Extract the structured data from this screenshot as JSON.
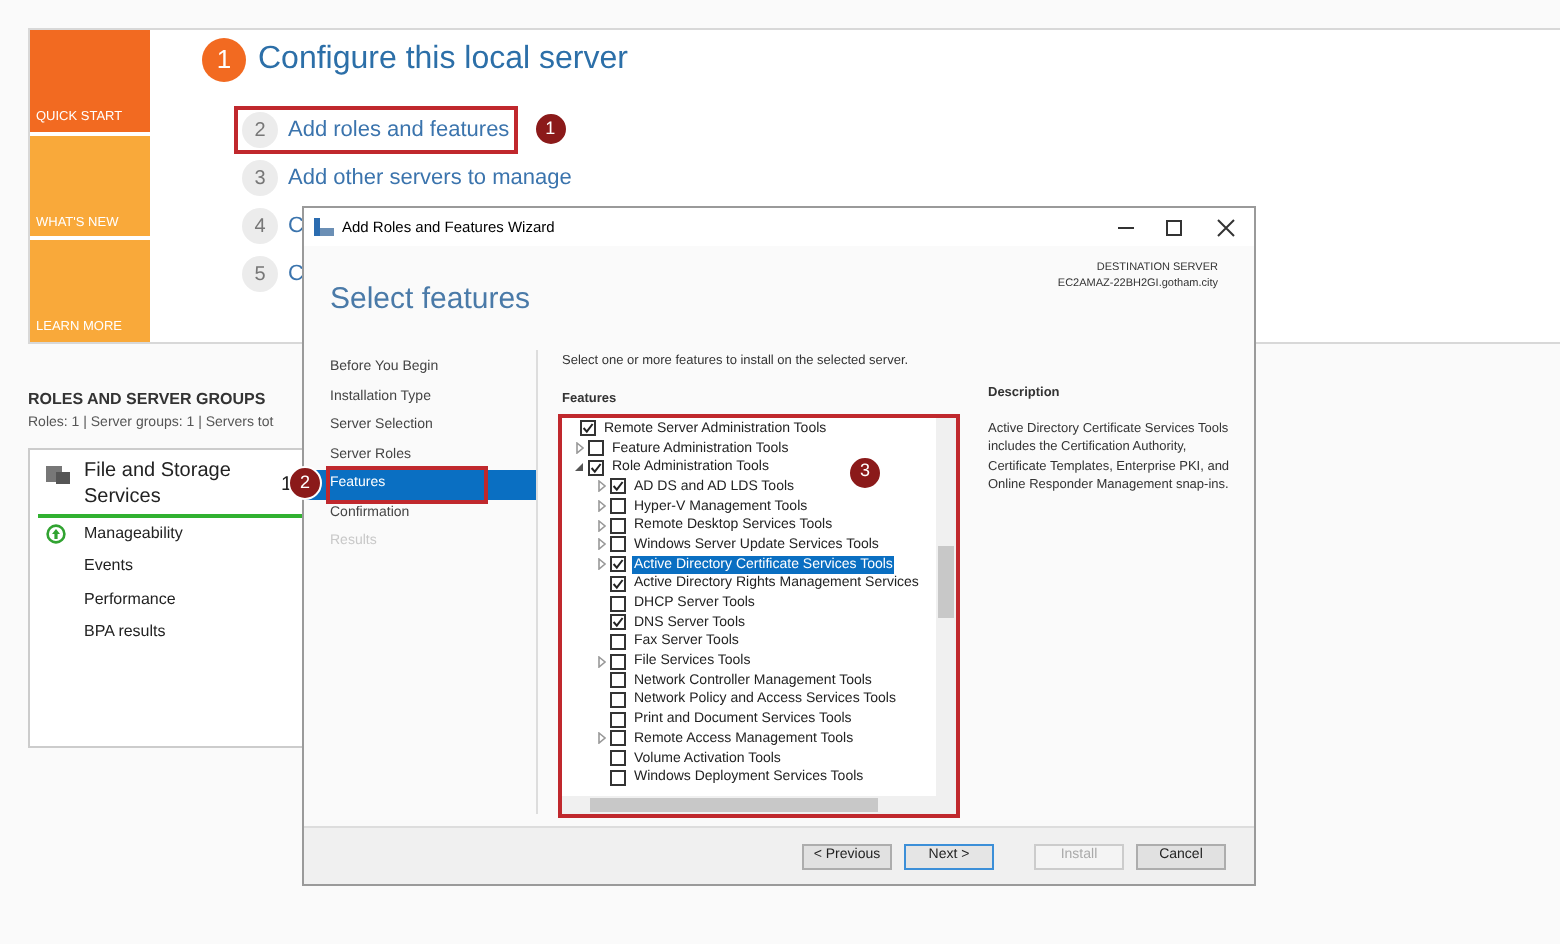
{
  "tiles": [
    {
      "label": "QUICK START",
      "selected": true
    },
    {
      "label": "WHAT'S NEW",
      "selected": false
    },
    {
      "label": "LEARN MORE",
      "selected": false
    }
  ],
  "quick_start": {
    "number": "1",
    "title": "Configure this local server",
    "steps": [
      {
        "number": "2",
        "label": "Add roles and features",
        "highlighted": true,
        "callout": "1"
      },
      {
        "number": "3",
        "label": "Add other servers to manage",
        "highlighted": false
      },
      {
        "number": "4",
        "label": "C",
        "highlighted": false
      },
      {
        "number": "5",
        "label": "C",
        "highlighted": false
      }
    ]
  },
  "roles_and_groups": {
    "heading": "ROLES AND SERVER GROUPS",
    "summary": "Roles: 1  |  Server groups: 1  |  Servers tot",
    "card": {
      "title": "File and Storage Services",
      "count": "1",
      "items": [
        {
          "label": "Manageability",
          "kind": "status"
        },
        {
          "label": "Events",
          "kind": "plain"
        },
        {
          "label": "Performance",
          "kind": "plain"
        },
        {
          "label": "BPA results",
          "kind": "plain"
        }
      ]
    }
  },
  "wizard": {
    "title": "Add Roles and Features Wizard",
    "heading": "Select features",
    "destination_label": "DESTINATION SERVER",
    "destination_server": "EC2AMAZ-22BH2GI.gotham.city",
    "nav": [
      {
        "label": "Before You Begin",
        "selected": false,
        "disabled": false
      },
      {
        "label": "Installation Type",
        "selected": false,
        "disabled": false
      },
      {
        "label": "Server Selection",
        "selected": false,
        "disabled": false
      },
      {
        "label": "Server Roles",
        "selected": false,
        "disabled": false
      },
      {
        "label": "Features",
        "selected": true,
        "disabled": false,
        "highlighted": true,
        "callout": "2"
      },
      {
        "label": "Confirmation",
        "selected": false,
        "disabled": false
      },
      {
        "label": "Results",
        "selected": false,
        "disabled": true
      }
    ],
    "instruction": "Select one or more features to install on the selected server.",
    "features_label": "Features",
    "tree_highlighted": true,
    "tree_callout": "3",
    "tree": [
      {
        "label": "Remote Server Administration Tools",
        "checked": true,
        "selected": false,
        "children": [
          {
            "label": "Feature Administration Tools",
            "checked": false,
            "selected": false,
            "expanded": false
          },
          {
            "label": "Role Administration Tools",
            "checked": true,
            "selected": false,
            "expanded": true,
            "children": [
              {
                "label": "AD DS and AD LDS Tools",
                "checked": true,
                "selected": false,
                "expanded": false
              },
              {
                "label": "Hyper-V Management Tools",
                "checked": false,
                "selected": false,
                "expanded": false
              },
              {
                "label": "Remote Desktop Services Tools",
                "checked": false,
                "selected": false,
                "expanded": false
              },
              {
                "label": "Windows Server Update Services Tools",
                "checked": false,
                "selected": false,
                "expanded": false
              },
              {
                "label": "Active Directory Certificate Services Tools",
                "checked": true,
                "selected": true,
                "expanded": false
              },
              {
                "label": "Active Directory Rights Management Services",
                "checked": true,
                "selected": false
              },
              {
                "label": "DHCP Server Tools",
                "checked": false,
                "selected": false
              },
              {
                "label": "DNS Server Tools",
                "checked": true,
                "selected": false
              },
              {
                "label": "Fax Server Tools",
                "checked": false,
                "selected": false
              },
              {
                "label": "File Services Tools",
                "checked": false,
                "selected": false,
                "expanded": false
              },
              {
                "label": "Network Controller Management Tools",
                "checked": false,
                "selected": false
              },
              {
                "label": "Network Policy and Access Services Tools",
                "checked": false,
                "selected": false
              },
              {
                "label": "Print and Document Services Tools",
                "checked": false,
                "selected": false
              },
              {
                "label": "Remote Access Management Tools",
                "checked": false,
                "selected": false,
                "expanded": false
              },
              {
                "label": "Volume Activation Tools",
                "checked": false,
                "selected": false
              },
              {
                "label": "Windows Deployment Services Tools",
                "checked": false,
                "selected": false
              }
            ]
          }
        ]
      }
    ],
    "description_label": "Description",
    "description": "Active Directory Certificate Services Tools includes the Certification Authority, Certificate Templates, Enterprise PKI, and Online Responder Management snap-ins.",
    "buttons": [
      {
        "label": "< Previous",
        "disabled": false,
        "default": false
      },
      {
        "label": "Next >",
        "disabled": false,
        "default": true
      },
      {
        "label": "Install",
        "disabled": true,
        "default": false
      },
      {
        "label": "Cancel",
        "disabled": false,
        "default": false
      }
    ]
  }
}
